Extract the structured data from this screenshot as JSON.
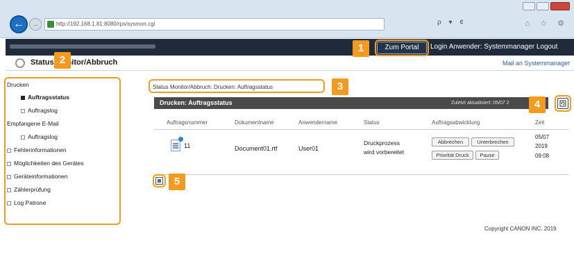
{
  "browser": {
    "url": "http://192.168.1.81:8080/rps/sysmon.cgi",
    "back_icon": "←",
    "forward_icon": "→",
    "address_tools": "ρ ▾ ¢",
    "tab_tools": "⌂ ☆ ⚙"
  },
  "header": {
    "portal_button": "Zum Portal",
    "login_text": "Login Anwender: Systemmanager Logout",
    "app_title": "Status Monitor/Abbruch",
    "mail_link": "Mail an Systemmanager"
  },
  "sidebar": {
    "items": [
      {
        "label": "Drucken",
        "kind": "head"
      },
      {
        "label": "Auftragsstatus",
        "kind": "sub",
        "active": true
      },
      {
        "label": "Auftragslog",
        "kind": "sub"
      },
      {
        "label": "Empfangene E-Mail",
        "kind": "head"
      },
      {
        "label": "Auftragslog",
        "kind": "sub"
      },
      {
        "label": "Fehlerinformationen",
        "kind": "top"
      },
      {
        "label": "Möglichkeiten des Gerätes",
        "kind": "top"
      },
      {
        "label": "Geräteinformationen",
        "kind": "top"
      },
      {
        "label": "Zählerprüfung",
        "kind": "top"
      },
      {
        "label": "Log Patrone",
        "kind": "top"
      }
    ]
  },
  "main": {
    "breadcrumb": "Status Monitor/Abbruch: Drucken: Auftragsstatus",
    "panel_title": "Drucken: Auftragsstatus",
    "updated": "Zuletzt aktualisiert: 05/07 2",
    "columns": [
      "Auftragsnummer",
      "Dokumentname",
      "Anwendername",
      "Status",
      "Auftragsabwicklung",
      "Zeit"
    ],
    "row": {
      "number": "11",
      "document": "Document01.rtf",
      "user": "User01",
      "status_line1": "Druckprozess",
      "status_line2": "wird vorbereitet",
      "time_line1": "05/07",
      "time_line2": "2019",
      "time_line3": "09:08",
      "actions": [
        "Abbrechen",
        "Unterbrechen",
        "Priorität Druck",
        "Pause"
      ]
    }
  },
  "footer": {
    "copyright": "Copyright CANON INC. 2019"
  },
  "callouts": [
    "1",
    "2",
    "3",
    "4",
    "5"
  ],
  "colors": {
    "callout": "#f39a1f",
    "header_dark": "#1f2b3a",
    "panel_header": "#4a4a4a",
    "browser_bar": "#d9e4f1"
  }
}
